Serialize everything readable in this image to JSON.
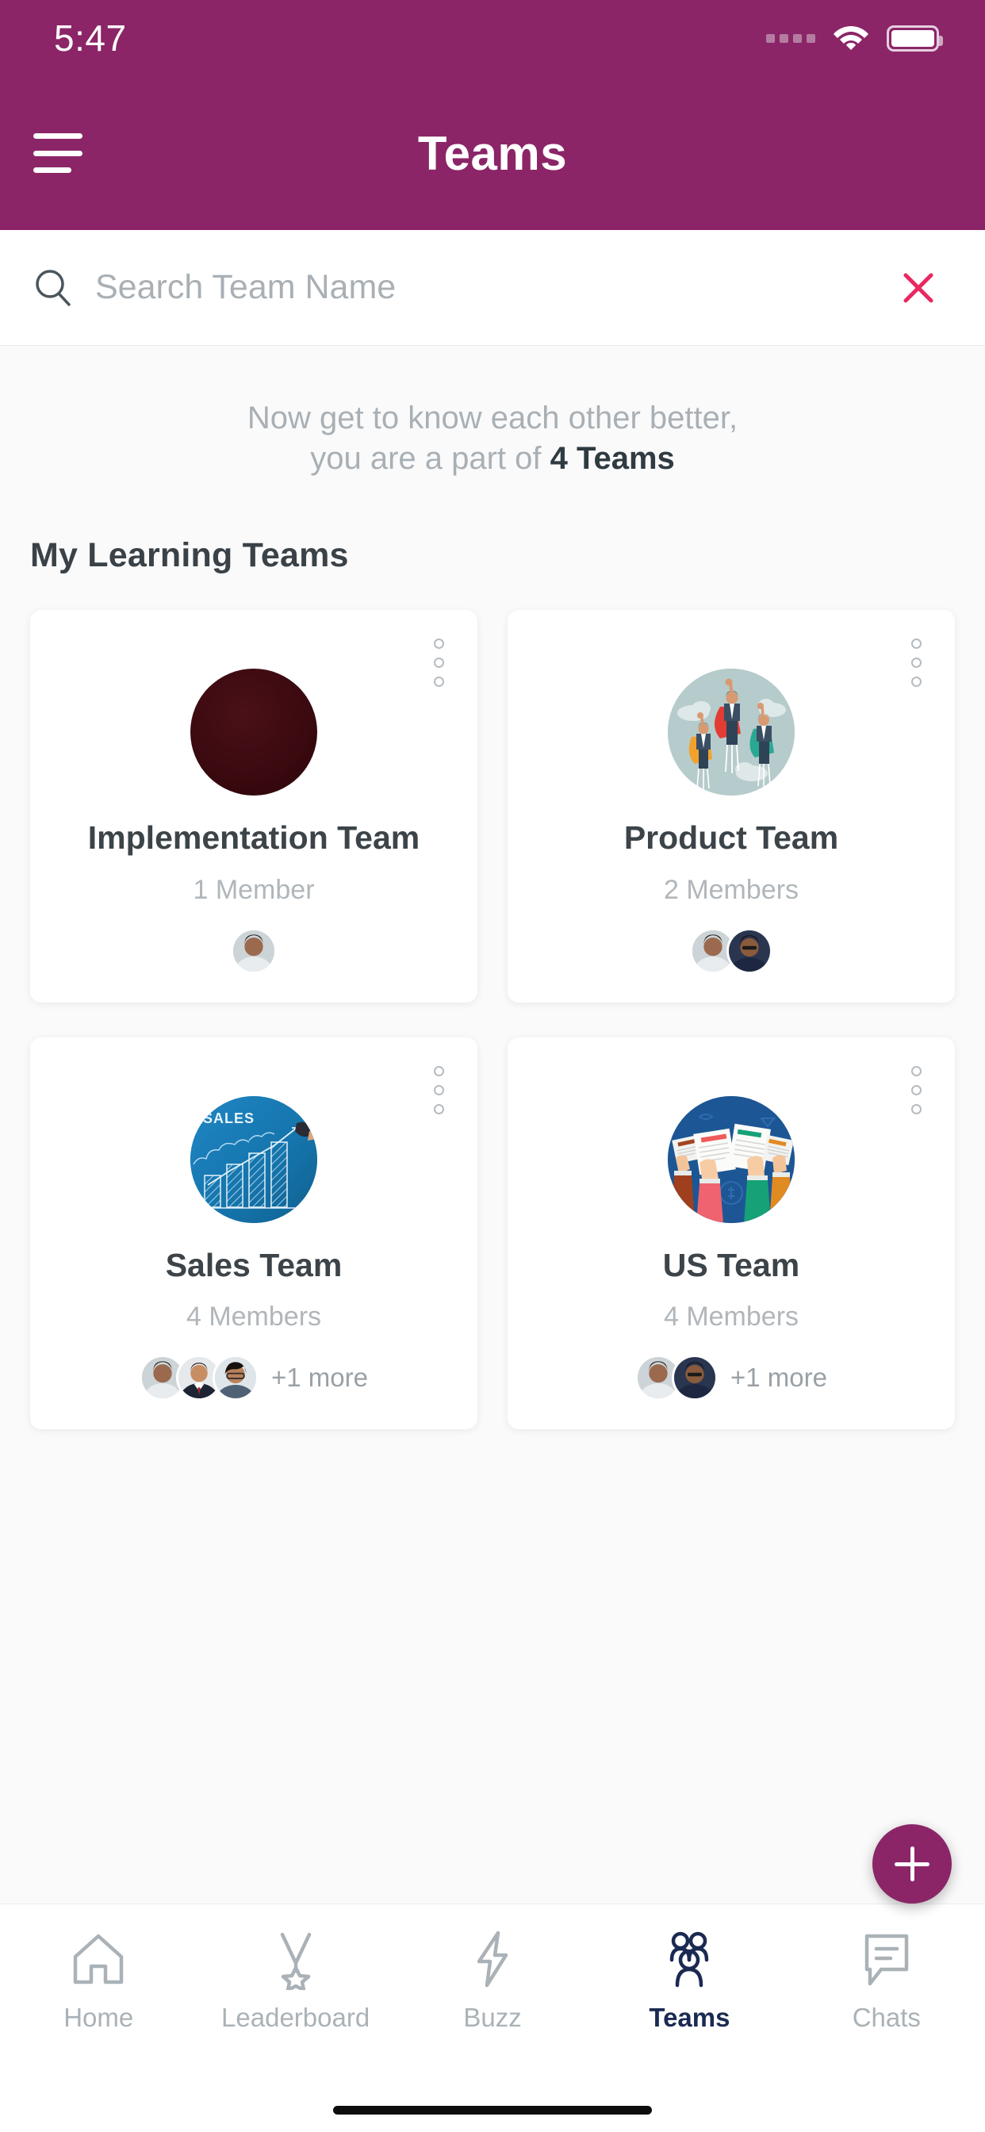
{
  "status_bar": {
    "time": "5:47",
    "signal_icon": "signal-dots-icon",
    "wifi_icon": "wifi-icon",
    "battery_icon": "battery-full-icon"
  },
  "app_bar": {
    "menu_icon": "hamburger-menu-icon",
    "title": "Teams"
  },
  "search": {
    "icon": "search-icon",
    "placeholder": "Search Team Name",
    "value": "",
    "clear_icon": "close-x-icon",
    "clear_color": "#e8285f"
  },
  "greeting": {
    "line1": "Now get to know each other better,",
    "line2_prefix": "you are a part of ",
    "line2_bold": "4 Teams"
  },
  "section": {
    "title": "My Learning Teams"
  },
  "teams": [
    {
      "name": "Implementation Team",
      "member_count": "1 Member",
      "menu_icon": "more-options-icon",
      "avatar_icon": "dark-maroon-circle-avatar",
      "avatar_color": "#3d0b11",
      "avatars": 1,
      "more_label": ""
    },
    {
      "name": "Product Team",
      "member_count": "2 Members",
      "menu_icon": "more-options-icon",
      "avatar_icon": "flying-superhero-businessmen-illustration",
      "avatar_color": "#b6cbcb",
      "avatars": 2,
      "more_label": ""
    },
    {
      "name": "Sales Team",
      "member_count": "4 Members",
      "menu_icon": "more-options-icon",
      "avatar_icon": "sales-bar-chart-illustration",
      "avatar_color": "#1a7bb8",
      "avatars": 3,
      "more_label": "+1 more"
    },
    {
      "name": "US Team",
      "member_count": "4 Members",
      "menu_icon": "more-options-icon",
      "avatar_icon": "hands-holding-documents-illustration",
      "avatar_color": "#1d5694",
      "avatars": 2,
      "more_label": "+1 more"
    }
  ],
  "fab": {
    "icon": "plus-icon",
    "color": "#8b2567"
  },
  "bottom_nav": {
    "active_color": "#1b2a52",
    "inactive_color": "#aab2b7",
    "items": [
      {
        "label": "Home",
        "icon": "home-icon",
        "active": false
      },
      {
        "label": "Leaderboard",
        "icon": "medal-icon",
        "active": false
      },
      {
        "label": "Buzz",
        "icon": "lightning-icon",
        "active": false
      },
      {
        "label": "Teams",
        "icon": "people-icon",
        "active": true
      },
      {
        "label": "Chats",
        "icon": "chat-bubble-icon",
        "active": false
      }
    ]
  },
  "theme": {
    "header": "#8b2567",
    "accent": "#8b2567",
    "page_bg": "#fafafa"
  }
}
